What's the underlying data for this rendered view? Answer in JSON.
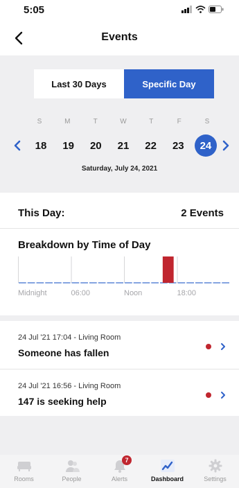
{
  "status": {
    "time": "5:05"
  },
  "nav": {
    "title": "Events"
  },
  "segment": {
    "options": [
      "Last 30 Days",
      "Specific Day"
    ],
    "selected": "Specific Day"
  },
  "calendar": {
    "weekdays": [
      "S",
      "M",
      "T",
      "W",
      "T",
      "F",
      "S"
    ],
    "days": [
      "18",
      "19",
      "20",
      "21",
      "22",
      "23",
      "24"
    ],
    "selected_day": "24",
    "date_label": "Saturday, July 24, 2021"
  },
  "summary": {
    "label": "This Day:",
    "count": "2 Events"
  },
  "breakdown": {
    "title": "Breakdown by Time of Day",
    "ticks": [
      "Midnight",
      "06:00",
      "Noon",
      "18:00"
    ]
  },
  "chart_data": {
    "type": "bar",
    "x_unit": "hour of day",
    "xlim": [
      0,
      24
    ],
    "series": [
      {
        "hours": [
          16.93,
          17.07
        ]
      }
    ],
    "ticks": [
      "Midnight",
      "06:00",
      "Noon",
      "18:00"
    ]
  },
  "events": [
    {
      "meta": "24 Jul '21 17:04 - Living Room",
      "desc": "Someone has fallen"
    },
    {
      "meta": "24 Jul '21 16:56 - Living Room",
      "desc": "147 is seeking help"
    }
  ],
  "tabs": [
    {
      "label": "Rooms",
      "icon": "couch-icon"
    },
    {
      "label": "People",
      "icon": "people-icon"
    },
    {
      "label": "Alerts",
      "icon": "bell-icon",
      "badge": "7"
    },
    {
      "label": "Dashboard",
      "icon": "chart-icon"
    },
    {
      "label": "Settings",
      "icon": "gear-icon"
    }
  ],
  "colors": {
    "accent": "#2f62c9",
    "alert": "#c0262f",
    "panel": "#efeff1"
  }
}
